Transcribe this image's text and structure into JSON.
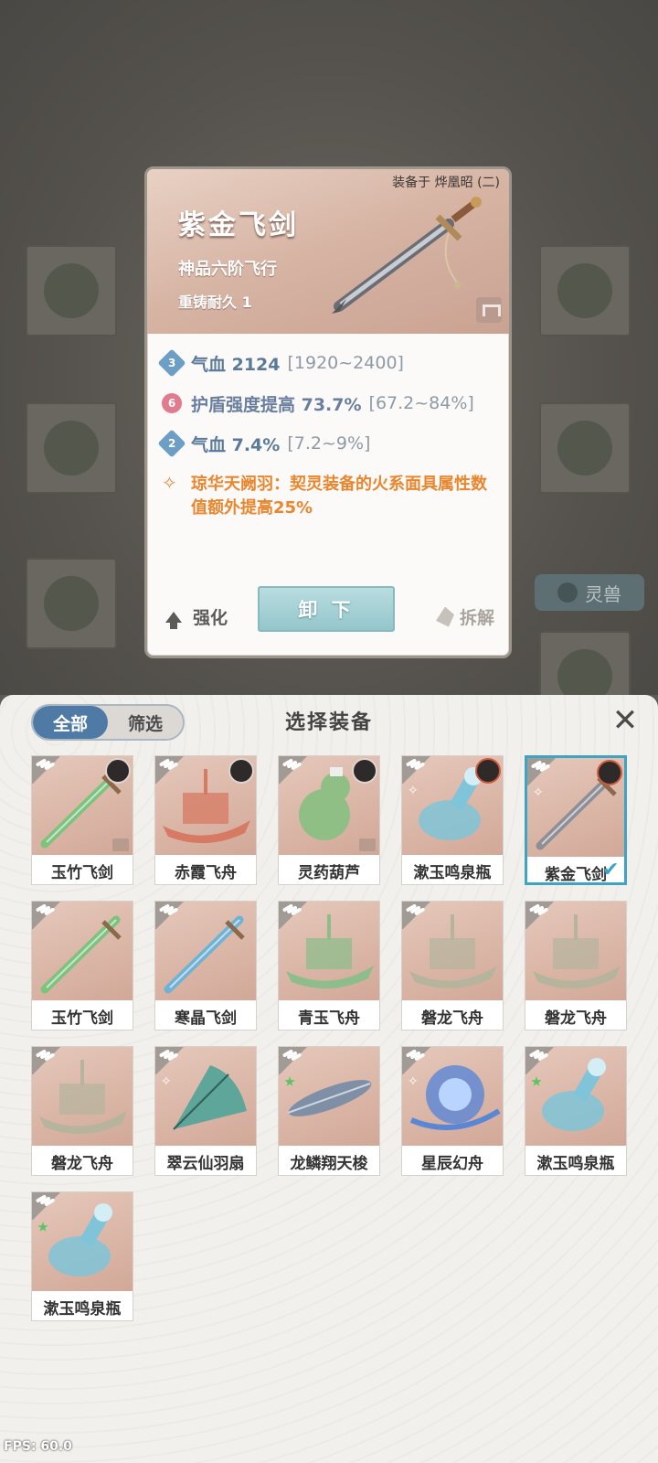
{
  "detail": {
    "equipped_on": "装备于 烨凰昭 (二)",
    "name": "紫金飞剑",
    "grade": "神品六阶飞行",
    "recast": "重铸耐久 1",
    "stats": [
      {
        "badge": "3",
        "label": "气血 2124",
        "range": "[1920~2400]",
        "color": "blue"
      },
      {
        "badge": "6",
        "label": "护盾强度提高 73.7%",
        "range": "[67.2~84%]",
        "color": "pink"
      },
      {
        "badge": "2",
        "label": "气血 7.4%",
        "range": "[7.2~9%]",
        "color": "blue"
      }
    ],
    "skill_text": "琼华天阙羽：契灵装备的火系面具属性数值额外提高25%",
    "unequip_label": "卸 下",
    "enhance_label": "强化",
    "dismantle_label": "拆解"
  },
  "background": {
    "tag_label": "灵兽"
  },
  "panel": {
    "title": "选择装备",
    "tabs": [
      {
        "label": "全部",
        "active": true
      },
      {
        "label": "筛选",
        "active": false
      }
    ],
    "close_icon": "close-icon",
    "items": [
      {
        "name": "玉竹飞剑",
        "type": "sword",
        "color": "#7cc47a",
        "portrait": true,
        "locked": true,
        "selected": false
      },
      {
        "name": "赤霞飞舟",
        "type": "boat",
        "color": "#d77a63",
        "portrait": true,
        "locked": false,
        "selected": false
      },
      {
        "name": "灵药葫芦",
        "type": "gourd",
        "color": "#8fbf84",
        "portrait": true,
        "locked": true,
        "selected": false
      },
      {
        "name": "漱玉鸣泉瓶",
        "type": "bottle",
        "color": "#7fc4d8",
        "portrait": true,
        "locked": false,
        "selected": false,
        "mark": "fire"
      },
      {
        "name": "紫金飞剑",
        "type": "sword",
        "color": "#8e8f95",
        "portrait": true,
        "locked": false,
        "selected": true,
        "mark": "fire"
      },
      {
        "name": "玉竹飞剑",
        "type": "sword",
        "color": "#7cc47a",
        "portrait": false,
        "locked": false,
        "selected": false
      },
      {
        "name": "寒晶飞剑",
        "type": "sword",
        "color": "#6fb3d4",
        "portrait": false,
        "locked": false,
        "selected": false
      },
      {
        "name": "青玉飞舟",
        "type": "boat",
        "color": "#8dbd8b",
        "portrait": false,
        "locked": false,
        "selected": false
      },
      {
        "name": "磐龙飞舟",
        "type": "boat",
        "color": "#b7b49d",
        "portrait": false,
        "locked": false,
        "selected": false
      },
      {
        "name": "磐龙飞舟",
        "type": "boat",
        "color": "#b7b49d",
        "portrait": false,
        "locked": false,
        "selected": false
      },
      {
        "name": "磐龙飞舟",
        "type": "boat",
        "color": "#b7b49d",
        "portrait": false,
        "locked": false,
        "selected": false
      },
      {
        "name": "翠云仙羽扇",
        "type": "fan",
        "color": "#5ea59a",
        "portrait": false,
        "locked": false,
        "selected": false,
        "mark": "fire"
      },
      {
        "name": "龙鳞翔天梭",
        "type": "shuttle",
        "color": "#7f8fa5",
        "portrait": false,
        "locked": false,
        "selected": false,
        "mark": "green"
      },
      {
        "name": "星辰幻舟",
        "type": "orb",
        "color": "#5a86d6",
        "portrait": false,
        "locked": false,
        "selected": false,
        "mark": "fire"
      },
      {
        "name": "漱玉鸣泉瓶",
        "type": "bottle",
        "color": "#7fc4d8",
        "portrait": false,
        "locked": false,
        "selected": false,
        "mark": "green"
      },
      {
        "name": "漱玉鸣泉瓶",
        "type": "bottle",
        "color": "#7fc4d8",
        "portrait": false,
        "locked": false,
        "selected": false,
        "mark": "green"
      }
    ]
  },
  "fps": "FPS: 60.0"
}
